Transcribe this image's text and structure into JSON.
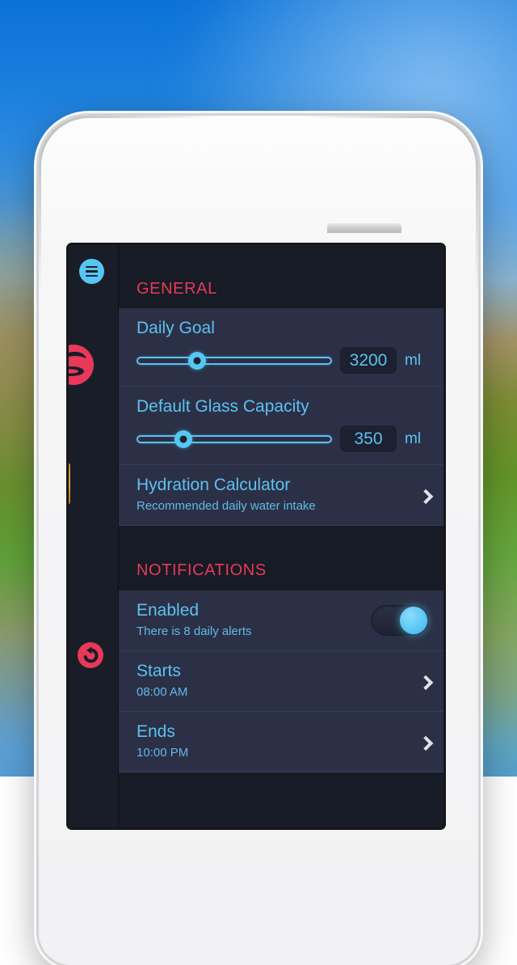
{
  "device": {
    "type": "smartphone-mockup",
    "frame_color": "#f4f4f6",
    "elements": [
      "camera",
      "proximity-sensor",
      "earpiece-speaker",
      "sleep-button",
      "volume-buttons",
      "mute-switch"
    ]
  },
  "app": {
    "theme": {
      "screen_bg": "#171b26",
      "row_bg": "#2b3046",
      "accent_blue": "#5cc2f0",
      "accent_red": "#e8395a",
      "badge_bg": "#1c2030",
      "divider": "#363c55"
    },
    "rail": {
      "menu_icon": "hamburger-menu-icon",
      "glass_icon": "water-glass-icon",
      "undo_icon": "undo-reset-icon"
    },
    "sections": [
      {
        "id": "general",
        "header": "GENERAL",
        "rows": [
          {
            "id": "daily-goal",
            "type": "slider",
            "title": "Daily Goal",
            "value": "3200",
            "unit": "ml",
            "fill_percent": 31
          },
          {
            "id": "default-glass-capacity",
            "type": "slider",
            "title": "Default Glass Capacity",
            "value": "350",
            "unit": "ml",
            "fill_percent": 24
          },
          {
            "id": "hydration-calculator",
            "type": "disclosure",
            "title": "Hydration Calculator",
            "subtitle": "Recommended daily water intake"
          }
        ]
      },
      {
        "id": "notifications",
        "header": "NOTIFICATIONS",
        "rows": [
          {
            "id": "enabled",
            "type": "toggle",
            "title": "Enabled",
            "subtitle": "There is 8 daily alerts",
            "state": "on"
          },
          {
            "id": "starts",
            "type": "disclosure",
            "title": "Starts",
            "subtitle": "08:00 AM"
          },
          {
            "id": "ends",
            "type": "disclosure",
            "title": "Ends",
            "subtitle": "10:00 PM"
          }
        ]
      }
    ]
  }
}
